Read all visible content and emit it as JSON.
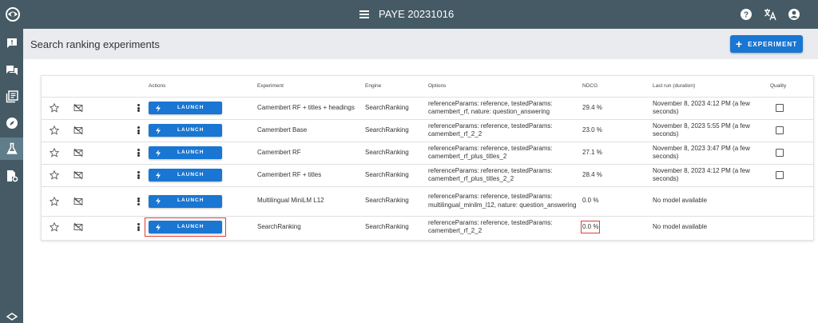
{
  "app": {
    "title": "PAYE 20231016"
  },
  "top_icons": [
    "help-icon",
    "translate-icon",
    "account-icon"
  ],
  "sidebar": {
    "items": [
      {
        "name": "feedback-icon",
        "active": false
      },
      {
        "name": "forum-icon",
        "active": false
      },
      {
        "name": "library-books-icon",
        "active": false
      },
      {
        "name": "explore-icon",
        "active": false
      },
      {
        "name": "science-flask-icon",
        "active": true
      },
      {
        "name": "settings-file-icon",
        "active": false
      }
    ]
  },
  "header": {
    "page_title": "Search ranking experiments",
    "add_button_label": "EXPERIMENT"
  },
  "table": {
    "columns": {
      "actions": "Actions",
      "experiment": "Experiment",
      "engine": "Engine",
      "options": "Options",
      "ndcg": "NDCG",
      "last_run": "Last run (duration)",
      "quality": "Quality"
    },
    "launch_label": "LAUNCH",
    "rows": [
      {
        "experiment": "Camembert RF + titles + headings",
        "engine": "SearchRanking",
        "options": "referenceParams: reference, testedParams: camembert_rf, nature: question_answering",
        "ndcg": "29.4 %",
        "last_run": "November 8, 2023 4:12 PM (a few seconds)"
      },
      {
        "experiment": "Camembert Base",
        "engine": "SearchRanking",
        "options": "referenceParams: reference, testedParams: camembert_rf_2_2",
        "ndcg": "23.0 %",
        "last_run": "November 8, 2023 5:55 PM (a few seconds)"
      },
      {
        "experiment": "Camembert RF",
        "engine": "SearchRanking",
        "options": "referenceParams: reference, testedParams: camembert_rf_plus_titles_2",
        "ndcg": "27.1 %",
        "last_run": "November 8, 2023 3:47 PM (a few seconds)"
      },
      {
        "experiment": "Camembert RF + titles",
        "engine": "SearchRanking",
        "options": "referenceParams: reference, testedParams: camembert_rf_plus_titles_2_2",
        "ndcg": "28.4 %",
        "last_run": "November 8, 2023 4:12 PM (a few seconds)"
      },
      {
        "experiment": "Multilingual MiniLM L12",
        "engine": "SearchRanking",
        "options": "referenceParams: reference, testedParams: multilingual_minilm_l12, nature: question_answering",
        "ndcg": "0.0 %",
        "last_run": "No model available"
      },
      {
        "experiment": "SearchRanking",
        "engine": "SearchRanking",
        "options": "referenceParams: reference, testedParams: camembert_rf_2_2",
        "ndcg": "0.0 %",
        "last_run": "No model available"
      }
    ]
  },
  "colors": {
    "topbar": "#455a64",
    "accent": "#1976d2",
    "highlight": "#e53935"
  }
}
